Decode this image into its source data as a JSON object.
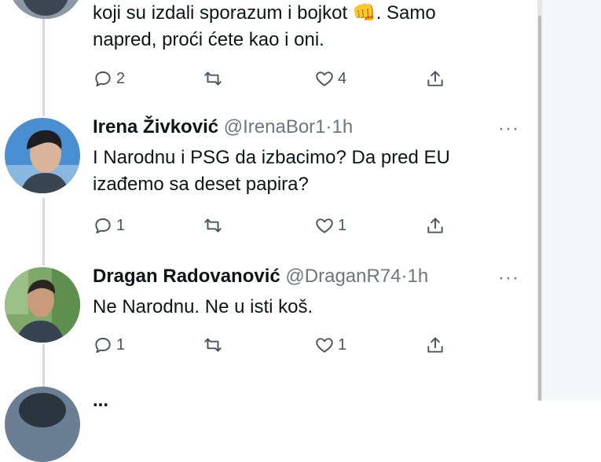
{
  "tweets": [
    {
      "text_line1": "koji su izdali sporazum i bojkot 👊. Samo",
      "text_line2": "napred, proći ćete kao i oni.",
      "replies": "2",
      "likes": "4"
    },
    {
      "name": "Irena Živković",
      "handle": "@IrenaBor1",
      "separator": "·",
      "time": "1h",
      "text_line1": "I Narodnu i PSG da izbacimo? Da pred EU",
      "text_line2": "izađemo sa deset papira?",
      "replies": "1",
      "likes": "1"
    },
    {
      "name": "Dragan Radovanović",
      "handle": "@DraganR74",
      "separator": "·",
      "time": "1h",
      "text_line1": "Ne Narodnu. Ne u isti koš.",
      "replies": "1",
      "likes": "1"
    }
  ],
  "partial_name": "...",
  "more_glyph": "···",
  "icons": {
    "reply": "reply-icon",
    "retweet": "retweet-icon",
    "like": "like-icon",
    "share": "share-icon"
  },
  "colors": {
    "icon_gray": "#4b5560",
    "text_gray": "#6e7781",
    "thread_line": "#d5dade"
  }
}
